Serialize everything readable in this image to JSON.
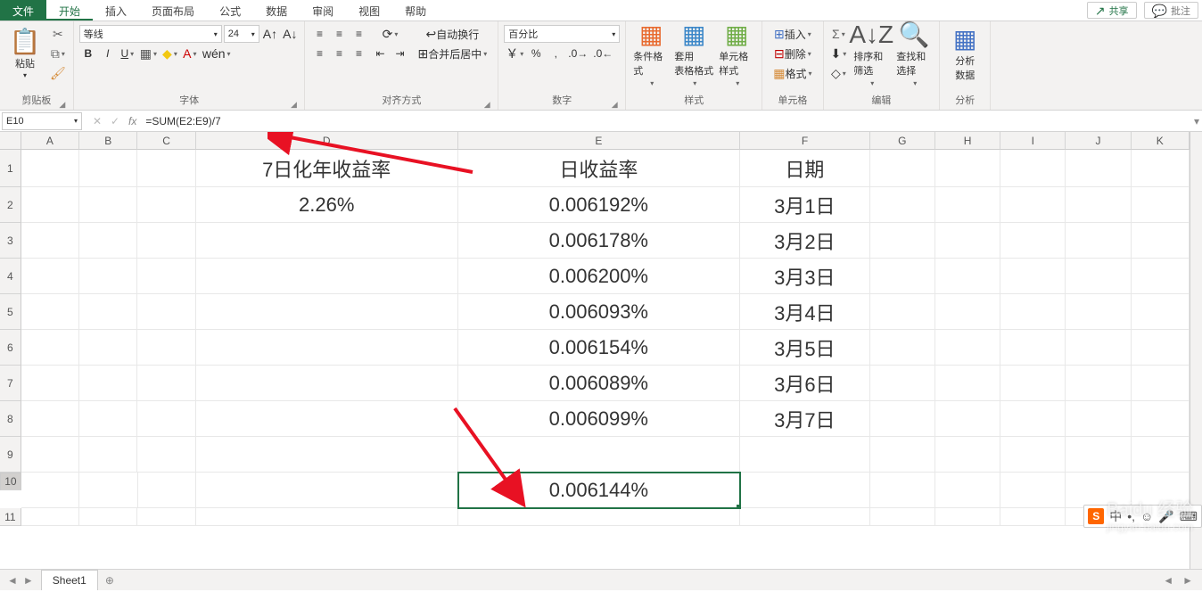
{
  "tabs": {
    "file": "文件",
    "home": "开始",
    "insert": "插入",
    "layout": "页面布局",
    "formulas": "公式",
    "data": "数据",
    "review": "审阅",
    "view": "视图",
    "help": "帮助",
    "share": "共享",
    "comment": "批注"
  },
  "ribbon": {
    "clipboard": {
      "label": "剪贴板",
      "paste": "粘贴"
    },
    "font": {
      "label": "字体",
      "name": "等线",
      "size": "24"
    },
    "align": {
      "label": "对齐方式",
      "wrap": "自动换行",
      "merge": "合并后居中"
    },
    "number": {
      "label": "数字",
      "format": "百分比"
    },
    "styles": {
      "label": "样式",
      "cond": "条件格式",
      "table": "套用\n表格格式",
      "cell": "单元格样式"
    },
    "cells": {
      "label": "单元格",
      "insert": "插入",
      "delete": "删除",
      "format": "格式"
    },
    "editing": {
      "label": "编辑",
      "sort": "排序和筛选",
      "find": "查找和选择"
    },
    "analysis": {
      "label": "分析",
      "analyze": "分析\n数据"
    }
  },
  "namebox": "E10",
  "formula": "=SUM(E2:E9)/7",
  "cols": [
    "A",
    "B",
    "C",
    "D",
    "E",
    "F",
    "G",
    "H",
    "I",
    "J",
    "K"
  ],
  "grid": {
    "D1": "7日化年收益率",
    "E1": "日收益率",
    "F1": "日期",
    "D2": "2.26%",
    "E2": "0.006192%",
    "F2": "3月1日",
    "E3": "0.006178%",
    "F3": "3月2日",
    "E4": "0.006200%",
    "F4": "3月3日",
    "E5": "0.006093%",
    "F5": "3月4日",
    "E6": "0.006154%",
    "F6": "3月5日",
    "E7": "0.006089%",
    "F7": "3月6日",
    "E8": "0.006099%",
    "F8": "3月7日",
    "E10": "0.006144%"
  },
  "sheet": {
    "name": "Sheet1"
  },
  "ime": {
    "logo": "S",
    "chars": "中"
  },
  "watermark": {
    "main": "Baidu 经验",
    "sub": "jingyan.baidu.com"
  }
}
